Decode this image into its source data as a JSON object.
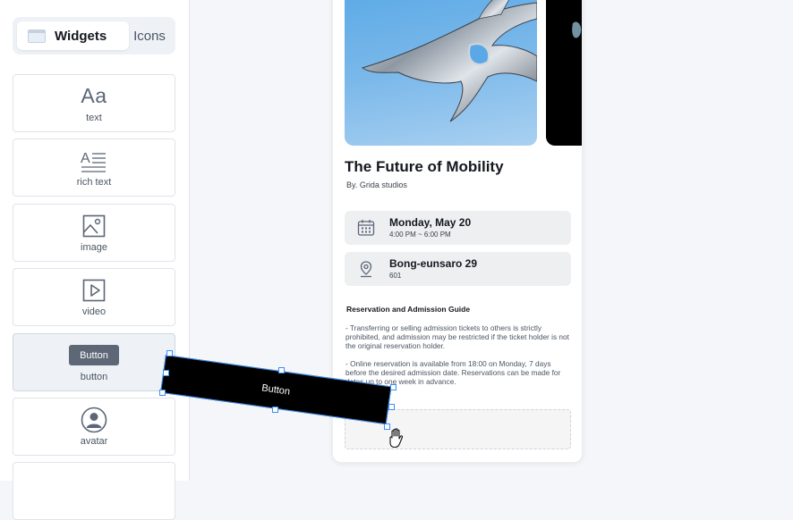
{
  "sidebar": {
    "tabs": [
      {
        "label": "Widgets",
        "active": true
      },
      {
        "label": "Icons",
        "active": false
      }
    ],
    "widgets": [
      {
        "label": "text",
        "icon": "text-aa-icon",
        "glyph": "Aa"
      },
      {
        "label": "rich text",
        "icon": "rich-text-icon"
      },
      {
        "label": "image",
        "icon": "image-icon"
      },
      {
        "label": "video",
        "icon": "video-play-icon"
      },
      {
        "label": "button",
        "icon": "button-preview",
        "preview_label": "Button",
        "selected": true
      },
      {
        "label": "avatar",
        "icon": "avatar-icon"
      }
    ]
  },
  "card": {
    "title": "The Future of Mobility",
    "byline": "By. Grida studios",
    "date": {
      "main": "Monday, May 20",
      "sub": "4:00 PM ~ 6:00 PM",
      "icon": "calendar-icon"
    },
    "location": {
      "main": "Bong-eunsaro 29",
      "sub": "601",
      "icon": "location-pin-icon"
    },
    "guide_title": "Reservation and Admission Guide",
    "guide_paragraphs": [
      "- Transferring or selling admission tickets to others is strictly prohibited, and admission may be restricted if the ticket holder is not the original reservation holder.",
      "- Online reservation is available from 18:00 on Monday, 7 days before the desired admission date. Reservations can be made for dates up to one week in advance."
    ]
  },
  "dragging": {
    "label": "Button"
  },
  "colors": {
    "accent": "#3a8df0",
    "selection": "#3a8df0",
    "button_preview": "#5d6776"
  }
}
